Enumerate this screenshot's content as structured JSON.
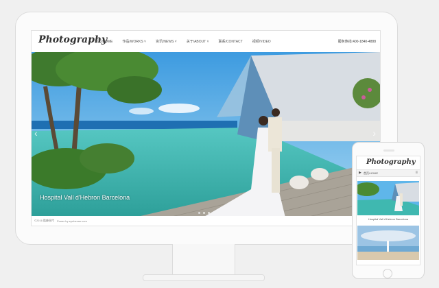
{
  "desktop": {
    "logo": "Photography",
    "nav": [
      {
        "label": "首页/HOME",
        "icon": "none"
      },
      {
        "label": "作品/WORKS",
        "icon": "chevron-down-icon"
      },
      {
        "label": "资讯/NEWS",
        "icon": "chevron-down-icon"
      },
      {
        "label": "关于/ABOUT",
        "icon": "chevron-down-icon"
      },
      {
        "label": "联系/CONTACT",
        "icon": "none"
      },
      {
        "label": "视频/VIDEO",
        "icon": "none"
      }
    ],
    "hotline": "服务热线:400-1840-4888",
    "hero_caption": "Hospital Vall d'Hebron Barcelona",
    "prev_arrow": "‹",
    "next_arrow": "›",
    "slides_total": 3,
    "active_slide": 1,
    "footer_copyright": "©2016 酷峰宣传",
    "footer_credit": "Power by eyuhexan.com"
  },
  "mobile": {
    "logo": "Photography",
    "nav_label": "首页/HOME",
    "play_icon": "▶",
    "menu_icon": "≡",
    "caption": "Hospital Vall d'Hebron Barcelona"
  },
  "colors": {
    "sky": "#5fb6ea",
    "pool": "#3fb8b0",
    "glass": "#b9cfe3"
  }
}
